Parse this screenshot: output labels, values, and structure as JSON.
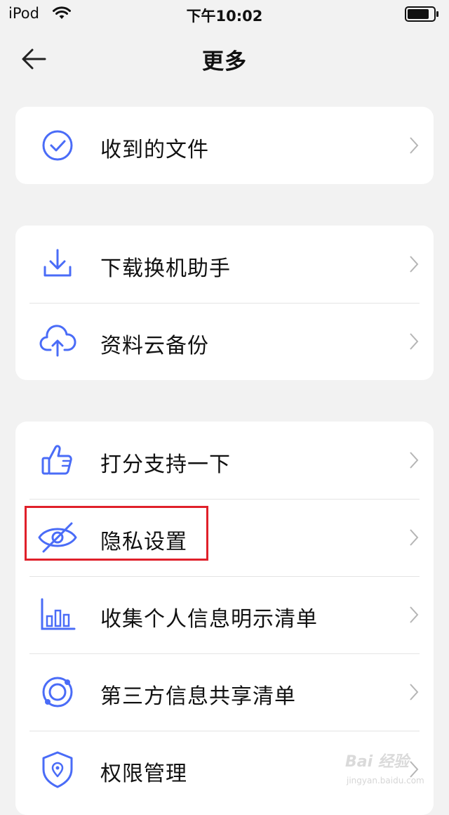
{
  "status_bar": {
    "carrier": "iPod",
    "time": "下午10:02"
  },
  "header": {
    "title": "更多",
    "back_icon": "arrow-left-icon"
  },
  "groups": [
    {
      "items": [
        {
          "label": "收到的文件",
          "icon": "check-circle-icon"
        }
      ]
    },
    {
      "items": [
        {
          "label": "下载换机助手",
          "icon": "download-icon"
        },
        {
          "label": "资料云备份",
          "icon": "cloud-upload-icon"
        }
      ]
    },
    {
      "items": [
        {
          "label": "打分支持一下",
          "icon": "thumbs-up-icon"
        },
        {
          "label": "隐私设置",
          "icon": "eye-off-icon"
        },
        {
          "label": "收集个人信息明示清单",
          "icon": "bar-chart-icon"
        },
        {
          "label": "第三方信息共享清单",
          "icon": "orbit-icon"
        },
        {
          "label": "权限管理",
          "icon": "shield-location-icon"
        }
      ]
    }
  ],
  "annotation": {
    "highlight_color": "#e0202a",
    "highlighted_item": "隐私设置"
  },
  "colors": {
    "accent": "#4a6cf7",
    "background": "#f2f2f2",
    "card": "#ffffff"
  },
  "watermark": {
    "main": "Bai 经验",
    "sub": "jingyan.baidu.com"
  }
}
